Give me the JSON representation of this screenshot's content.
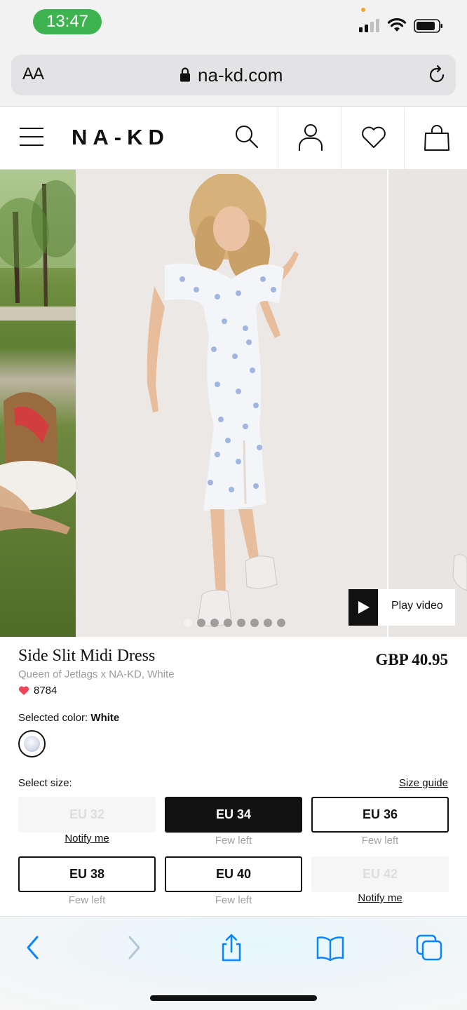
{
  "status_bar": {
    "time": "13:47"
  },
  "browser": {
    "text_size_label": "AA",
    "url": "na-kd.com"
  },
  "header": {
    "logo": "NA-KD"
  },
  "carousel": {
    "total_images": 8,
    "active_index": 0,
    "play_video_label": "Play video"
  },
  "product": {
    "name": "Side Slit Midi Dress",
    "price": "GBP 40.95",
    "subtitle": "Queen of Jetlags x NA-KD, White",
    "likes": "8784",
    "selected_color_label": "Selected color:",
    "selected_color_value": "White",
    "select_size_label": "Select size:",
    "size_guide_label": "Size guide",
    "sizes": [
      {
        "label": "EU 32",
        "note": "Notify me",
        "state": "unavailable"
      },
      {
        "label": "EU 34",
        "note": "Few left",
        "state": "selected"
      },
      {
        "label": "EU 36",
        "note": "Few left",
        "state": "available"
      },
      {
        "label": "EU 38",
        "note": "Few left",
        "state": "available"
      },
      {
        "label": "EU 40",
        "note": "Few left",
        "state": "available"
      },
      {
        "label": "EU 42",
        "note": "Notify me",
        "state": "unavailable"
      }
    ]
  },
  "colors": {
    "brand": "#111111",
    "like_heart": "#ef4456",
    "ios_blue": "#0a84ff",
    "status_pill": "#3fb34f"
  }
}
